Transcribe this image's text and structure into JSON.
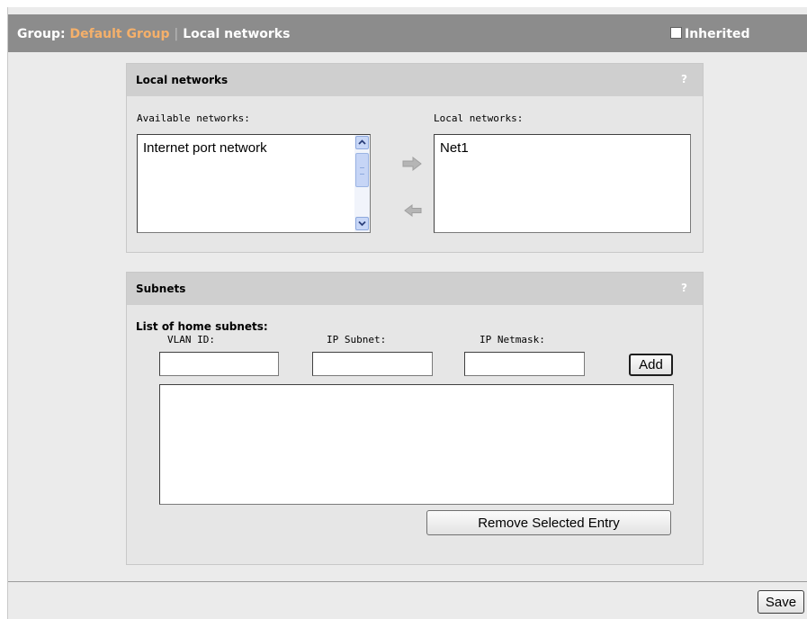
{
  "header": {
    "group_label": "Group:",
    "group_name": "Default Group",
    "separator": "|",
    "page_title": "Local networks",
    "inherited_label": "Inherited",
    "inherited_checked": false
  },
  "local_networks_panel": {
    "title": "Local networks",
    "help": "?",
    "available_label": "Available networks:",
    "available_items": [
      "Internet port network"
    ],
    "local_label": "Local networks:",
    "local_items": [
      "Net1"
    ],
    "icons": {
      "add": "arrow-right-icon",
      "remove": "arrow-left-icon"
    }
  },
  "subnets_panel": {
    "title": "Subnets",
    "help": "?",
    "list_label": "List of home subnets:",
    "vlan_label": "VLAN ID:",
    "subnet_label": "IP Subnet:",
    "netmask_label": "IP Netmask:",
    "vlan_value": "",
    "subnet_value": "",
    "netmask_value": "",
    "add_button": "Add",
    "entries": [],
    "remove_button": "Remove Selected Entry"
  },
  "footer": {
    "save_button": "Save"
  },
  "colors": {
    "title_bar": "#8c8c8c",
    "group_name": "#f5b06a",
    "panel_header": "#cfcfcf",
    "panel_body": "#e6e6e6"
  }
}
